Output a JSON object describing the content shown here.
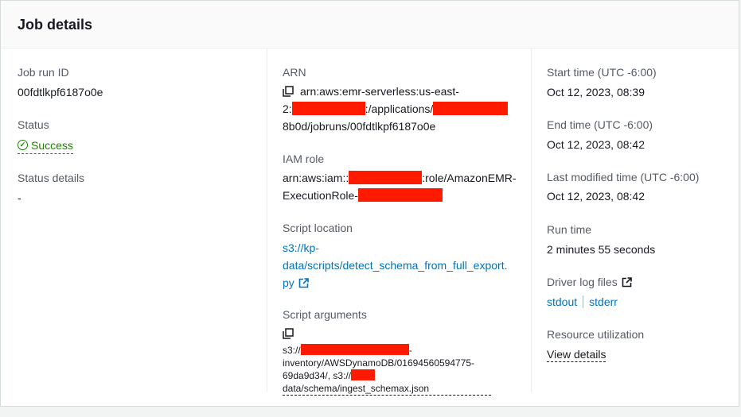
{
  "header": {
    "title": "Job details"
  },
  "col1": {
    "job_run_id_label": "Job run ID",
    "job_run_id": "00fdtlkpf6187o0e",
    "status_label": "Status",
    "status_value": "Success",
    "status_icon": "check-circle-icon",
    "status_details_label": "Status details",
    "status_details_value": "-"
  },
  "col2": {
    "arn_label": "ARN",
    "arn_line1": "arn:aws:emr-serverless:us-east-",
    "arn_line2_prefix": "2:",
    "arn_line2_mid": ":/applications/",
    "arn_line3": "8b0d/jobruns/00fdtlkpf6187o0e",
    "iam_label": "IAM role",
    "iam_line1_prefix": "arn:aws:iam::",
    "iam_line1_suffix": ":role/AmazonEMR-",
    "iam_line2_prefix": "ExecutionRole-",
    "script_location_label": "Script location",
    "script_location_line1": "s3://kp-",
    "script_location_line2": "data/scripts/detect_schema_from_full_export.",
    "script_location_line3": "py",
    "script_args_label": "Script arguments",
    "args_line1_prefix": "s3://",
    "args_line1_suffix": "-",
    "args_line2": "inventory/AWSDynamoDB/01694560594775-",
    "args_line3": "69da9d34/, s3://",
    "args_line4": "data/schema/ingest_schemax.json"
  },
  "col3": {
    "start_label": "Start time (UTC -6:00)",
    "start_value": "Oct 12, 2023, 08:39",
    "end_label": "End time (UTC -6:00)",
    "end_value": "Oct 12, 2023, 08:42",
    "modified_label": "Last modified time (UTC -6:00)",
    "modified_value": "Oct 12, 2023, 08:42",
    "run_time_label": "Run time",
    "run_time_value": "2 minutes 55 seconds",
    "driver_logs_label": "Driver log files",
    "stdout": "stdout",
    "stderr": "stderr",
    "resource_label": "Resource utilization",
    "view_details": "View details"
  },
  "colors": {
    "redaction": "#ff1a00",
    "link": "#0073bb",
    "success": "#1d8102"
  }
}
